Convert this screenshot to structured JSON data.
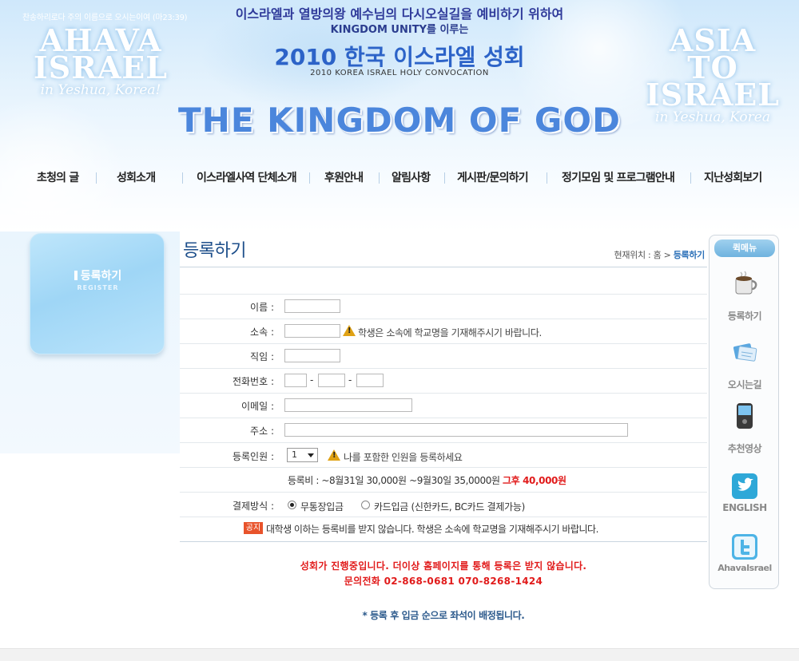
{
  "header": {
    "tagline": "찬송하리로다 주의 이름으로 오시는이여 (마23:39)",
    "brand_left": {
      "line1": "AHAVA",
      "line2": "ISRAEL",
      "sub": "in Yeshua, Korea!"
    },
    "brand_right": {
      "line1": "ASIA TO",
      "line2": "ISRAEL",
      "sub": "in Yeshua, Korea"
    },
    "line1": "이스라엘과 열방의왕 예수님의 다시오실길을 예비하기 위하여",
    "line2": "KINGDOM UNITY를 이루는",
    "title": "2010 한국 이스라엘 성회",
    "subtitle": "2010 KOREA ISRAEL HOLY CONVOCATION",
    "kingdom": "THE KINGDOM OF GOD"
  },
  "nav": {
    "items": [
      "초청의 글",
      "성회소개",
      "이스라엘사역 단체소개",
      "후원안내",
      "알림사항",
      "게시판/문의하기",
      "정기모임 및 프로그램안내",
      "지난성회보기"
    ]
  },
  "sidebar": {
    "title": "등록하기",
    "subtitle": "REGISTER"
  },
  "page": {
    "title": "등록하기",
    "breadcrumb_prefix": "현재위치 : 홈 > ",
    "breadcrumb_current": "등록하기"
  },
  "form": {
    "name_label": "이름 :",
    "affiliation_label": "소속 :",
    "affiliation_note": "학생은 소속에 학교명을 기재해주시기 바랍니다.",
    "position_label": "직임 :",
    "phone_label": "전화번호 :",
    "phone_sep": "-",
    "email_label": "이메일 :",
    "address_label": "주소 :",
    "headcount_label": "등록인원 :",
    "headcount_value": "1",
    "headcount_note": "나를 포함한 인원을 등록하세요",
    "fee_text": "등록비 : ~8월31일 30,000원   ~9월30일 35,0000원 ",
    "fee_red": "그후 40,000원",
    "payment_label": "결제방식 :",
    "payment_option1": "무통장입금",
    "payment_option2": "카드입금 (신한카드, BC카드 결제가능)",
    "notice_badge": "공지",
    "notice_text": "대학생 이하는 등록비를 받지 않습니다. 학생은 소속에 학교명을 기재해주시기 바랍니다."
  },
  "closed": {
    "line1": "성회가 진행중입니다. 더이상 홈페이지를 통해 등록은 받지 않습니다.",
    "line2": "문의전화 02-868-0681 070-8268-1424"
  },
  "seat_note": "* 등록 후 입금 순으로 좌석이 배정됩니다.",
  "quick_menu": {
    "title": "퀵메뉴",
    "items": [
      {
        "label": "등록하기",
        "icon": "coffee-cup-icon"
      },
      {
        "label": "오시는길",
        "icon": "map-cards-icon"
      },
      {
        "label": "추천영상",
        "icon": "video-phone-icon"
      },
      {
        "label": "ENGLISH",
        "icon": "bird-icon"
      },
      {
        "label": "AhavaIsrael",
        "icon": "twitter-icon"
      }
    ]
  }
}
